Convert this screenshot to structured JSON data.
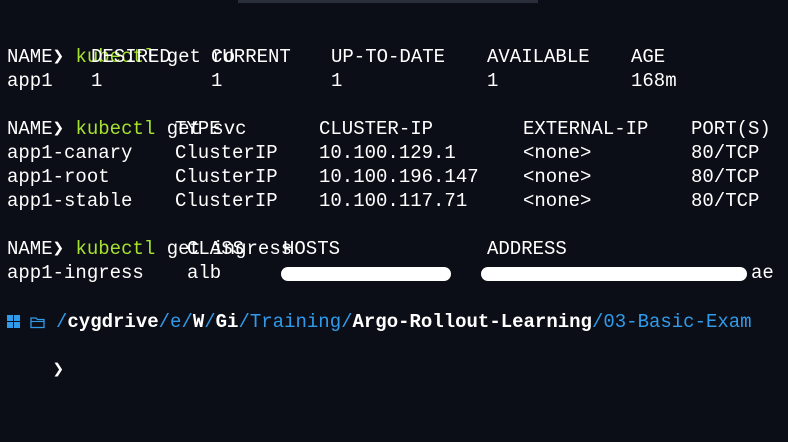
{
  "prompt": {
    "arrow": "❯"
  },
  "commands": [
    {
      "name": "kubectl",
      "args": "get ro"
    },
    {
      "name": "kubectl",
      "args": "get svc"
    },
    {
      "name": "kubectl",
      "args": "get ingress"
    }
  ],
  "rollouts": {
    "headers": [
      "NAME",
      "DESIRED",
      "CURRENT",
      "UP-TO-DATE",
      "AVAILABLE",
      "AGE"
    ],
    "rows": [
      [
        "app1",
        "1",
        "1",
        "1",
        "1",
        "168m"
      ]
    ]
  },
  "services": {
    "headers": [
      "NAME",
      "TYPE",
      "CLUSTER-IP",
      "EXTERNAL-IP",
      "PORT(S)"
    ],
    "rows": [
      [
        "app1-canary",
        "ClusterIP",
        "10.100.129.1",
        "<none>",
        "80/TCP"
      ],
      [
        "app1-root",
        "ClusterIP",
        "10.100.196.147",
        "<none>",
        "80/TCP"
      ],
      [
        "app1-stable",
        "ClusterIP",
        "10.100.117.71",
        "<none>",
        "80/TCP"
      ]
    ]
  },
  "ingress": {
    "headers": [
      "NAME",
      "CLASS",
      "HOSTS",
      "ADDRESS"
    ],
    "rows": [
      [
        "app1-ingress",
        "alb",
        "",
        "ae"
      ]
    ]
  },
  "path_prompt": {
    "icons": [
      "windows-icon",
      "folder-icon"
    ],
    "segments": [
      {
        "sep": "/",
        "text": "cygdrive",
        "style": "bold"
      },
      {
        "sep": "/",
        "text": "e",
        "style": "blue"
      },
      {
        "sep": "/",
        "text": "W",
        "style": "bold"
      },
      {
        "sep": "/",
        "text": "Gi",
        "style": "bold"
      },
      {
        "sep": "/",
        "text": "Training",
        "style": "blue"
      },
      {
        "sep": "/",
        "text": "Argo-Rollout-Learning",
        "style": "bold"
      },
      {
        "sep": "/",
        "text": "03-Basic-Exam",
        "style": "blue"
      }
    ]
  },
  "colors": {
    "background": "#0c0e17",
    "command": "#a6e22e",
    "path_blue": "#2f9bea",
    "text": "#ffffff"
  }
}
